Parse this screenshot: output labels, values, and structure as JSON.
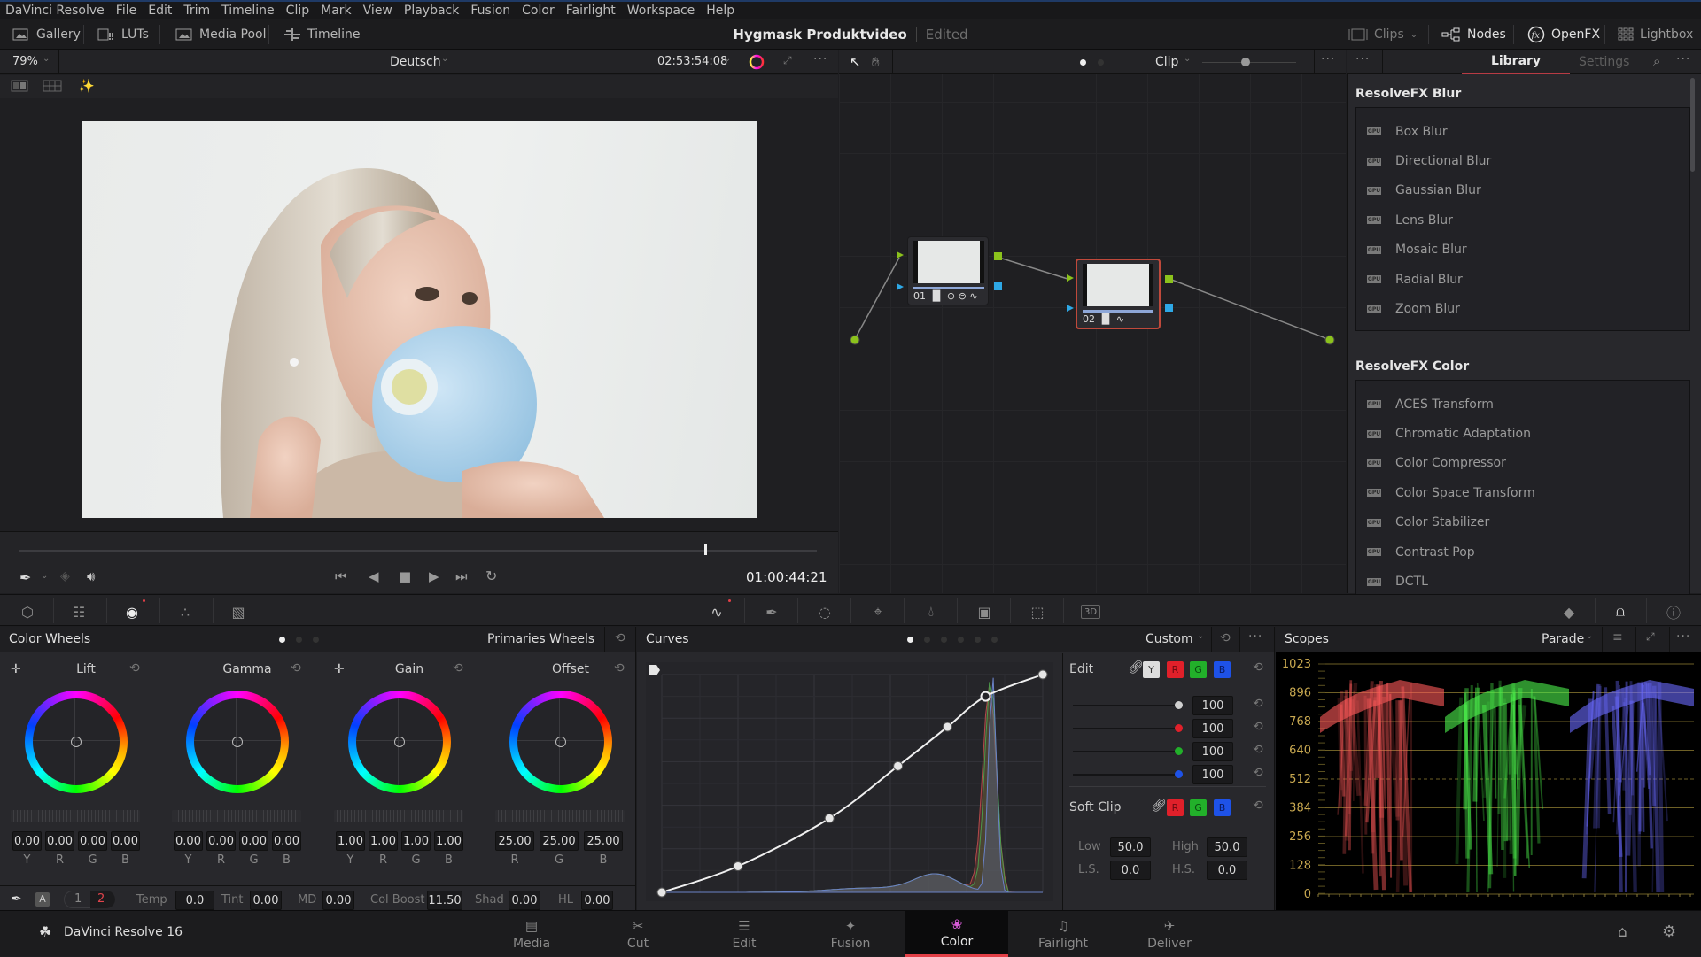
{
  "menu": [
    "DaVinci Resolve",
    "File",
    "Edit",
    "Trim",
    "Timeline",
    "Clip",
    "Mark",
    "View",
    "Playback",
    "Fusion",
    "Color",
    "Fairlight",
    "Workspace",
    "Help"
  ],
  "toolbar": {
    "left": [
      {
        "label": "Gallery",
        "icon": "gallery-icon"
      },
      {
        "label": "LUTs",
        "icon": "luts-icon"
      },
      {
        "label": "Media Pool",
        "icon": "media-pool-icon"
      },
      {
        "label": "Timeline",
        "icon": "timeline-icon"
      }
    ],
    "project_title": "Hygmask Produktvideo",
    "project_status": "Edited",
    "right": [
      {
        "label": "Clips",
        "icon": "clips-icon"
      },
      {
        "label": "Nodes",
        "icon": "nodes-icon"
      },
      {
        "label": "OpenFX",
        "icon": "openfx-icon"
      },
      {
        "label": "Lightbox",
        "icon": "lightbox-icon"
      }
    ]
  },
  "viewer": {
    "zoom": "79%",
    "clip_name": "Deutsch",
    "source_timecode": "02:53:54:08",
    "playhead_timecode": "01:00:44:21",
    "scrub_position": 0.86
  },
  "node_editor": {
    "mode": "Clip",
    "nodes": [
      {
        "id": "01",
        "tools": [
          "bars",
          "circle",
          "hsl",
          "curve"
        ],
        "selected": false
      },
      {
        "id": "02",
        "tools": [
          "bars",
          "curve"
        ],
        "selected": true
      }
    ]
  },
  "library": {
    "tabs": [
      "Library",
      "Settings"
    ],
    "active_tab": "Library",
    "sections": [
      {
        "title": "ResolveFX Blur",
        "items": [
          "Box Blur",
          "Directional Blur",
          "Gaussian Blur",
          "Lens Blur",
          "Mosaic Blur",
          "Radial Blur",
          "Zoom Blur"
        ]
      },
      {
        "title": "ResolveFX Color",
        "items": [
          "ACES Transform",
          "Chromatic Adaptation",
          "Color Compressor",
          "Color Space Transform",
          "Color Stabilizer",
          "Contrast Pop",
          "DCTL"
        ]
      }
    ],
    "badge": "GPU"
  },
  "color_wheels": {
    "title": "Color Wheels",
    "mode": "Primaries Wheels",
    "wheels": [
      {
        "name": "Lift",
        "values": [
          "0.00",
          "0.00",
          "0.00",
          "0.00"
        ],
        "channels": [
          "Y",
          "R",
          "G",
          "B"
        ]
      },
      {
        "name": "Gamma",
        "values": [
          "0.00",
          "0.00",
          "0.00",
          "0.00"
        ],
        "channels": [
          "Y",
          "R",
          "G",
          "B"
        ]
      },
      {
        "name": "Gain",
        "values": [
          "1.00",
          "1.00",
          "1.00",
          "1.00"
        ],
        "channels": [
          "Y",
          "R",
          "G",
          "B"
        ]
      },
      {
        "name": "Offset",
        "values": [
          "25.00",
          "25.00",
          "25.00"
        ],
        "channels": [
          "R",
          "G",
          "B"
        ]
      }
    ],
    "bottom": {
      "pages": [
        "1",
        "2"
      ],
      "auto_label": "A",
      "fields": [
        {
          "label": "Temp",
          "value": "0.0"
        },
        {
          "label": "Tint",
          "value": "0.00"
        },
        {
          "label": "MD",
          "value": "0.00"
        },
        {
          "label": "Col Boost",
          "value": "11.50"
        },
        {
          "label": "Shad",
          "value": "0.00"
        },
        {
          "label": "HL",
          "value": "0.00"
        }
      ]
    }
  },
  "curves": {
    "title": "Curves",
    "mode": "Custom",
    "points": [
      [
        0,
        0
      ],
      [
        0.2,
        0.12
      ],
      [
        0.44,
        0.34
      ],
      [
        0.62,
        0.58
      ],
      [
        0.75,
        0.76
      ],
      [
        0.85,
        0.9
      ],
      [
        1,
        1
      ]
    ],
    "edit": {
      "label": "Edit",
      "channels": [
        "Y",
        "R",
        "G",
        "B"
      ],
      "intensities": [
        {
          "channel": "Y",
          "value": "100",
          "color": "#d0d0d0"
        },
        {
          "channel": "R",
          "value": "100",
          "color": "#e0202a"
        },
        {
          "channel": "G",
          "value": "100",
          "color": "#22b02a"
        },
        {
          "channel": "B",
          "value": "100",
          "color": "#1e52e8"
        }
      ]
    },
    "soft_clip": {
      "label": "Soft Clip",
      "channels": [
        "R",
        "G",
        "B"
      ],
      "low_label": "Low",
      "low": "50.0",
      "high_label": "High",
      "high": "50.0",
      "ls_label": "L.S.",
      "ls": "0.0",
      "hs_label": "H.S.",
      "hs": "0.0"
    }
  },
  "scopes": {
    "title": "Scopes",
    "mode": "Parade",
    "scale": [
      "1023",
      "896",
      "768",
      "640",
      "512",
      "384",
      "256",
      "128",
      "0"
    ]
  },
  "pages": [
    "Media",
    "Cut",
    "Edit",
    "Fusion",
    "Color",
    "Fairlight",
    "Deliver"
  ],
  "active_page": "Color",
  "app_name": "DaVinci Resolve 16",
  "colors": {
    "accent": "#e23f47",
    "selected_node": "#c0493b",
    "scope_grid": "#8a7a3a"
  }
}
